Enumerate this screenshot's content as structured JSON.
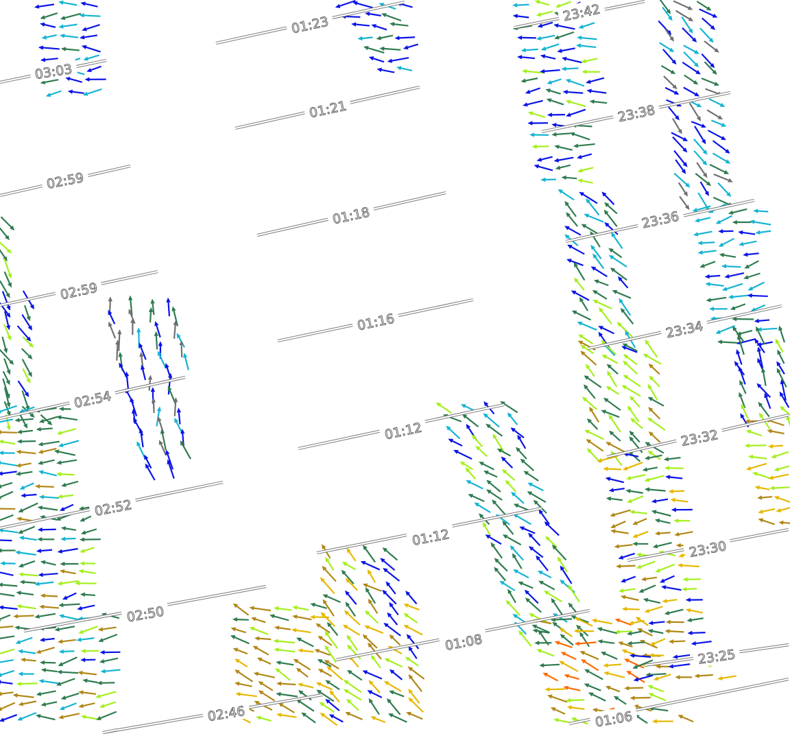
{
  "map": {
    "background": "#ffffff",
    "time_labels": [
      "03:03",
      "02:59",
      "02:59",
      "02:54",
      "02:52",
      "02:50",
      "02:46",
      "02:46",
      "01:23",
      "01:21",
      "01:18",
      "01:16",
      "01:12",
      "01:12",
      "01:08",
      "01:06",
      "23:42",
      "23:38",
      "23:36",
      "23:34",
      "23:32",
      "23:30",
      "23:25"
    ],
    "vector_palette": {
      "blue": "#0a14e6",
      "cyan": "#14b4d2",
      "teal_green": "#2e7b4f",
      "lime": "#a4ef1c",
      "olive": "#b08716",
      "gold": "#e6b800",
      "orange": "#ff6a00",
      "gray": "#707070"
    }
  }
}
